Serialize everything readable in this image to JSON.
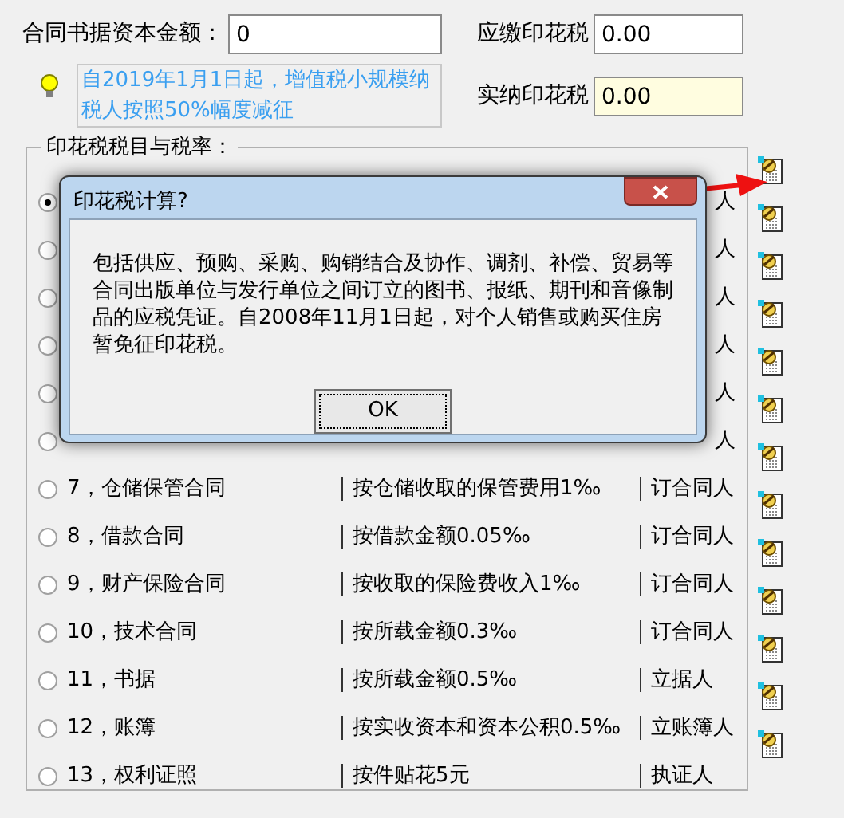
{
  "capital_label": "合同书据资本金额：",
  "capital_value": "0",
  "due_label": "应缴印花税",
  "due_value": "0.00",
  "notice": "自2019年1月1日起，增值税小规模纳税人按照50%幅度减征",
  "paid_label": "实纳印花税",
  "paid_value": "0.00",
  "group_title": "印花税税目与税率：",
  "rows": [
    {
      "selected": true,
      "signer": "人"
    },
    {
      "selected": false,
      "signer": "人"
    },
    {
      "selected": false,
      "signer": "人"
    },
    {
      "selected": false,
      "signer": "人"
    },
    {
      "selected": false,
      "signer": "人"
    },
    {
      "selected": false,
      "signer": "人"
    },
    {
      "selected": false,
      "name": "7，仓储保管合同",
      "rate": "按仓储收取的保管费用1‰",
      "signer": "订合同人"
    },
    {
      "selected": false,
      "name": "8，借款合同",
      "rate": "按借款金额0.05‰",
      "signer": "订合同人"
    },
    {
      "selected": false,
      "name": "9，财产保险合同",
      "rate": "按收取的保险费收入1‰",
      "signer": "订合同人"
    },
    {
      "selected": false,
      "name": "10，技术合同",
      "rate": "按所载金额0.3‰",
      "signer": "订合同人"
    },
    {
      "selected": false,
      "name": "11，书据",
      "rate": "按所载金额0.5‰",
      "signer": "立据人"
    },
    {
      "selected": false,
      "name": "12，账簿",
      "rate": "按实收资本和资本公积0.5‰",
      "signer": "立账簿人"
    },
    {
      "selected": false,
      "name": "13，权利证照",
      "rate": "按件贴花5元",
      "signer": "执证人"
    }
  ],
  "dialog": {
    "title": "印花税计算?",
    "message": "包括供应、预购、采购、购销结合及协作、调剂、补偿、贸易等合同出版单位与发行单位之间订立的图书、报纸、期刊和音像制品的应税凭证。自2008年11月1日起，对个人销售或购买住房暂免征印花税。",
    "button": "OK"
  }
}
